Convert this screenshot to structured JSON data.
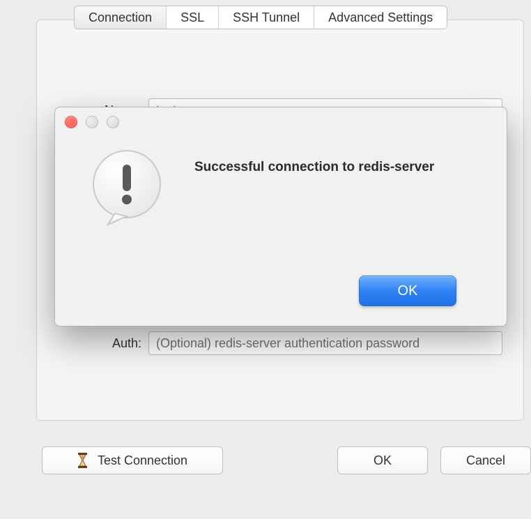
{
  "tabs": {
    "connection": "Connection",
    "ssl": "SSL",
    "ssh": "SSH Tunnel",
    "advanced": "Advanced Settings"
  },
  "form": {
    "name_label": "Name:",
    "name_value": "test",
    "auth_label": "Auth:",
    "auth_placeholder": "(Optional) redis-server authentication password"
  },
  "dialog": {
    "message": "Successful connection to redis-server",
    "ok_label": "OK"
  },
  "buttons": {
    "test_connection": "Test Connection",
    "ok": "OK",
    "cancel": "Cancel"
  }
}
